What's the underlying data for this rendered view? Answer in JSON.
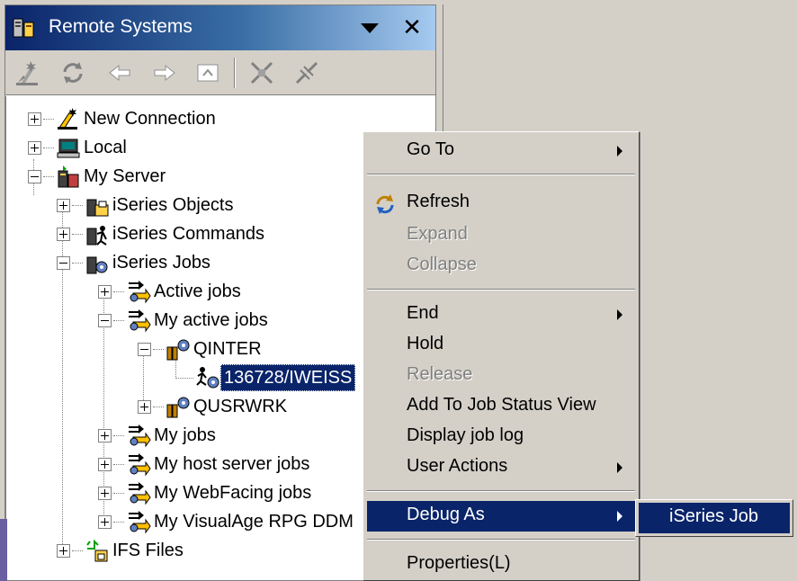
{
  "view": {
    "title": "Remote Systems"
  },
  "toolbar": {
    "buttons": [
      "new-connection-icon",
      "refresh-icon",
      "back-icon",
      "forward-icon",
      "up-icon",
      "collapse-all-icon",
      "link-icon"
    ]
  },
  "tree": {
    "new_connection": "New Connection",
    "local": "Local",
    "my_server": "My Server",
    "iseries_objects": "iSeries Objects",
    "iseries_commands": "iSeries Commands",
    "iseries_jobs": "iSeries Jobs",
    "active_jobs": "Active jobs",
    "my_active_jobs": "My active jobs",
    "qinter": "QINTER",
    "job_136728": "136728/IWEISS",
    "qusrwrk": "QUSRWRK",
    "my_jobs": "My jobs",
    "my_host_server_jobs": "My host server jobs",
    "my_webfacing_jobs": "My WebFacing jobs",
    "my_visualage_rpg_ddm": "My VisualAge RPG DDM",
    "ifs_files": "IFS Files"
  },
  "context_menu": {
    "go_to": "Go To",
    "refresh": "Refresh",
    "expand": "Expand",
    "collapse": "Collapse",
    "end": "End",
    "hold": "Hold",
    "release": "Release",
    "add_to_job_status_view": "Add To Job Status View",
    "display_job_log": "Display job log",
    "user_actions": "User Actions",
    "debug_as": "Debug As",
    "properties": "Properties(L)"
  },
  "submenu": {
    "iseries_job": "iSeries Job"
  },
  "colors": {
    "selection": "#0a246a",
    "title_gradient_start": "#0a246a",
    "title_gradient_end": "#a6caf0",
    "menu_bg": "#d4d0c8"
  }
}
